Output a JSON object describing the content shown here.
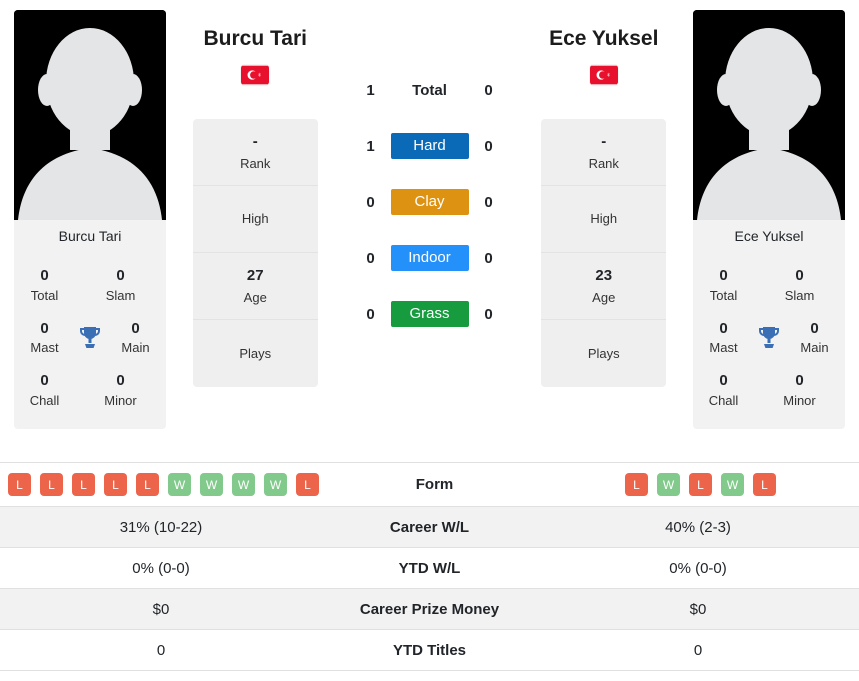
{
  "players": {
    "left": {
      "name": "Burcu Tari",
      "photo_caption": "Burcu Tari",
      "country": "Turkey",
      "flag_icon": "turkey-flag-icon",
      "trophies": {
        "total": "0",
        "total_label": "Total",
        "slam": "0",
        "slam_label": "Slam",
        "mast": "0",
        "mast_label": "Mast",
        "main": "0",
        "main_label": "Main",
        "chall": "0",
        "chall_label": "Chall",
        "minor": "0",
        "minor_label": "Minor"
      },
      "info": {
        "rank_value": "-",
        "rank_label": "Rank",
        "high_value": "",
        "high_label": "High",
        "age_value": "27",
        "age_label": "Age",
        "plays_value": "",
        "plays_label": "Plays"
      },
      "form": [
        "L",
        "L",
        "L",
        "L",
        "L",
        "W",
        "W",
        "W",
        "W",
        "L"
      ],
      "career_wl": "31% (10-22)",
      "ytd_wl": "0% (0-0)",
      "career_prize_money": "$0",
      "ytd_titles": "0"
    },
    "right": {
      "name": "Ece Yuksel",
      "photo_caption": "Ece Yuksel",
      "country": "Turkey",
      "flag_icon": "turkey-flag-icon",
      "trophies": {
        "total": "0",
        "total_label": "Total",
        "slam": "0",
        "slam_label": "Slam",
        "mast": "0",
        "mast_label": "Mast",
        "main": "0",
        "main_label": "Main",
        "chall": "0",
        "chall_label": "Chall",
        "minor": "0",
        "minor_label": "Minor"
      },
      "info": {
        "rank_value": "-",
        "rank_label": "Rank",
        "high_value": "",
        "high_label": "High",
        "age_value": "23",
        "age_label": "Age",
        "plays_value": "",
        "plays_label": "Plays"
      },
      "form": [
        "L",
        "W",
        "L",
        "W",
        "L"
      ],
      "career_wl": "40% (2-3)",
      "ytd_wl": "0% (0-0)",
      "career_prize_money": "$0",
      "ytd_titles": "0"
    }
  },
  "head_to_head": [
    {
      "label": "Total",
      "left": "1",
      "right": "0",
      "style": "plain",
      "color": ""
    },
    {
      "label": "Hard",
      "left": "1",
      "right": "0",
      "style": "badge",
      "color": "#0b6ab8"
    },
    {
      "label": "Clay",
      "left": "0",
      "right": "0",
      "style": "badge",
      "color": "#dd9311"
    },
    {
      "label": "Indoor",
      "left": "0",
      "right": "0",
      "style": "badge",
      "color": "#2490fa"
    },
    {
      "label": "Grass",
      "left": "0",
      "right": "0",
      "style": "badge",
      "color": "#169b3f"
    }
  ],
  "table_labels": {
    "form": "Form",
    "career_wl": "Career W/L",
    "ytd_wl": "YTD W/L",
    "career_prize_money": "Career Prize Money",
    "ytd_titles": "YTD Titles"
  },
  "colors": {
    "win_badge": "#82c98c",
    "loss_badge": "#ec6449",
    "trophy": "#3a6fb5",
    "flag_red": "#e8112d",
    "panel_bg": "#efefef",
    "row_shaded": "#f2f2f2"
  }
}
